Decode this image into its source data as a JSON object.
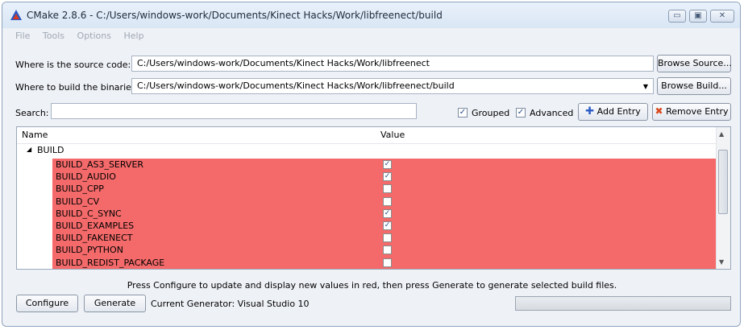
{
  "window": {
    "title": "CMake 2.8.6 - C:/Users/windows-work/Documents/Kinect Hacks/Work/libfreenect/build",
    "controls": {
      "minimize": "▭",
      "maximize": "▣",
      "close": "✕"
    }
  },
  "menu": [
    "File",
    "Tools",
    "Options",
    "Help"
  ],
  "source": {
    "label": "Where is the source code:",
    "value": "C:/Users/windows-work/Documents/Kinect Hacks/Work/libfreenect",
    "button": "Browse Source..."
  },
  "build": {
    "label": "Where to build the binaries:",
    "value": "C:/Users/windows-work/Documents/Kinect Hacks/Work/libfreenect/build",
    "button": "Browse Build..."
  },
  "search": {
    "label": "Search:",
    "value": ""
  },
  "options": {
    "grouped": {
      "label": "Grouped",
      "checked": true
    },
    "advanced": {
      "label": "Advanced",
      "checked": true
    }
  },
  "actions": {
    "add": "Add Entry",
    "remove": "Remove Entry"
  },
  "table": {
    "headers": {
      "name": "Name",
      "value": "Value"
    },
    "group": "BUILD",
    "row_color": "#f46a6a",
    "rows": [
      {
        "name": "BUILD_AS3_SERVER",
        "checked": true
      },
      {
        "name": "BUILD_AUDIO",
        "checked": true
      },
      {
        "name": "BUILD_CPP",
        "checked": false
      },
      {
        "name": "BUILD_CV",
        "checked": false
      },
      {
        "name": "BUILD_C_SYNC",
        "checked": true
      },
      {
        "name": "BUILD_EXAMPLES",
        "checked": true
      },
      {
        "name": "BUILD_FAKENECT",
        "checked": false
      },
      {
        "name": "BUILD_PYTHON",
        "checked": false
      },
      {
        "name": "BUILD_REDIST_PACKAGE",
        "checked": false
      }
    ]
  },
  "status_message": "Press Configure to update and display new values in red, then press Generate to generate selected build files.",
  "footer": {
    "configure": "Configure",
    "generate": "Generate",
    "generator": "Current Generator: Visual Studio 10",
    "progress": 0
  }
}
